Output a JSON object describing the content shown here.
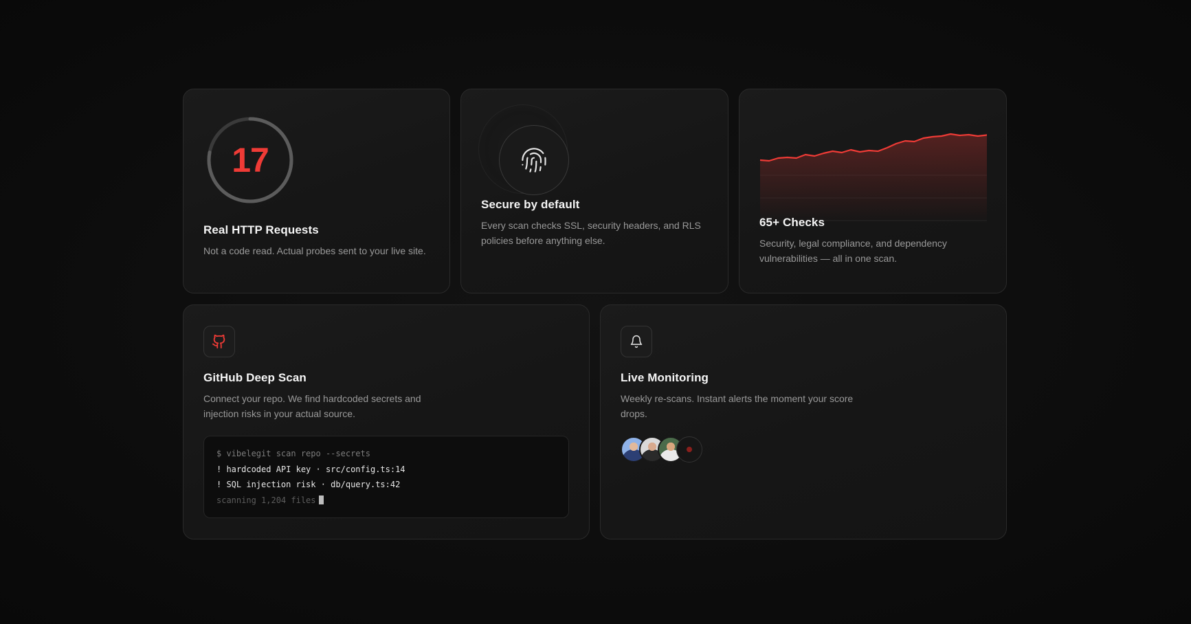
{
  "colors": {
    "accent": "#ef3b36",
    "background": "#0d0d0d",
    "card": "#181818",
    "text_muted": "#9a9a9a"
  },
  "cards": {
    "requests": {
      "counter": "17",
      "ring_progress": 0.78,
      "title": "Real HTTP Requests",
      "description": "Not a code read. Actual probes sent to your live site."
    },
    "secure": {
      "icon": "fingerprint-icon",
      "title": "Secure by default",
      "description": "Every scan checks SSL, security headers, and RLS policies before anything else."
    },
    "checks": {
      "title": "65+ Checks",
      "description": "Security, legal compliance, and dependency vulnerabilities — all in one scan.",
      "sparkline": [
        0.24,
        0.22,
        0.3,
        0.32,
        0.3,
        0.4,
        0.36,
        0.44,
        0.5,
        0.46,
        0.54,
        0.48,
        0.52,
        0.5,
        0.6,
        0.72,
        0.8,
        0.78,
        0.88,
        0.92,
        0.94,
        1.0,
        0.96,
        0.98,
        0.94,
        0.97
      ]
    },
    "github": {
      "icon": "github-icon",
      "title": "GitHub Deep Scan",
      "description": "Connect your repo. We find hardcoded secrets and injection risks in your actual source.",
      "terminal": {
        "command": "$ vibelegit scan repo --secrets",
        "finding_1": "! hardcoded API key · src/config.ts:14",
        "finding_2": "! SQL injection risk · db/query.ts:42",
        "status": "scanning 1,204 files"
      }
    },
    "monitoring": {
      "icon": "bell-icon",
      "title": "Live Monitoring",
      "description": "Weekly re-scans. Instant alerts the moment your score drops."
    }
  }
}
